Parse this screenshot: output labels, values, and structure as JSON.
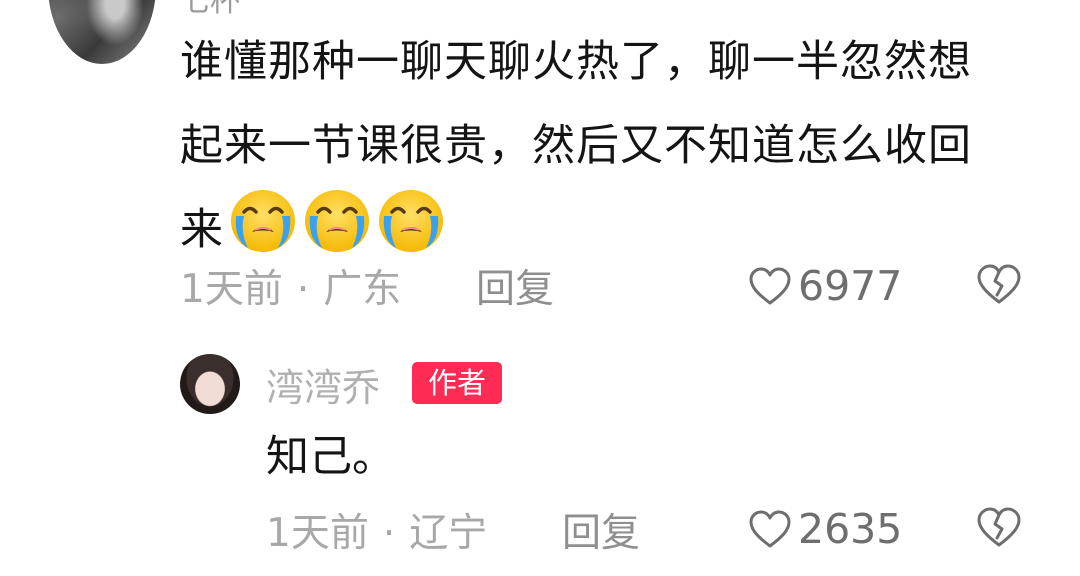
{
  "comment": {
    "username_partial": "七杯",
    "text": "谁懂那种一聊天聊火热了，聊一半忽然想起来一节课很贵，然后又不知道怎么收回来",
    "emojis": [
      "loudly-crying-face-icon",
      "loudly-crying-face-icon",
      "loudly-crying-face-icon"
    ],
    "time": "1天前",
    "separator": "·",
    "location": "广东",
    "reply_label": "回复",
    "like_count": "6977"
  },
  "reply": {
    "username": "湾湾乔",
    "badge": "作者",
    "text": "知己。",
    "time": "1天前",
    "separator": "·",
    "location": "辽宁",
    "reply_label": "回复",
    "like_count": "2635"
  },
  "colors": {
    "badge_bg": "#fe2c55",
    "text_primary": "#141414",
    "text_secondary": "#a8a8a8",
    "icon_gray": "#6e6e6e"
  },
  "icons": {
    "like": "heart-outline-icon",
    "dislike": "broken-heart-icon"
  }
}
